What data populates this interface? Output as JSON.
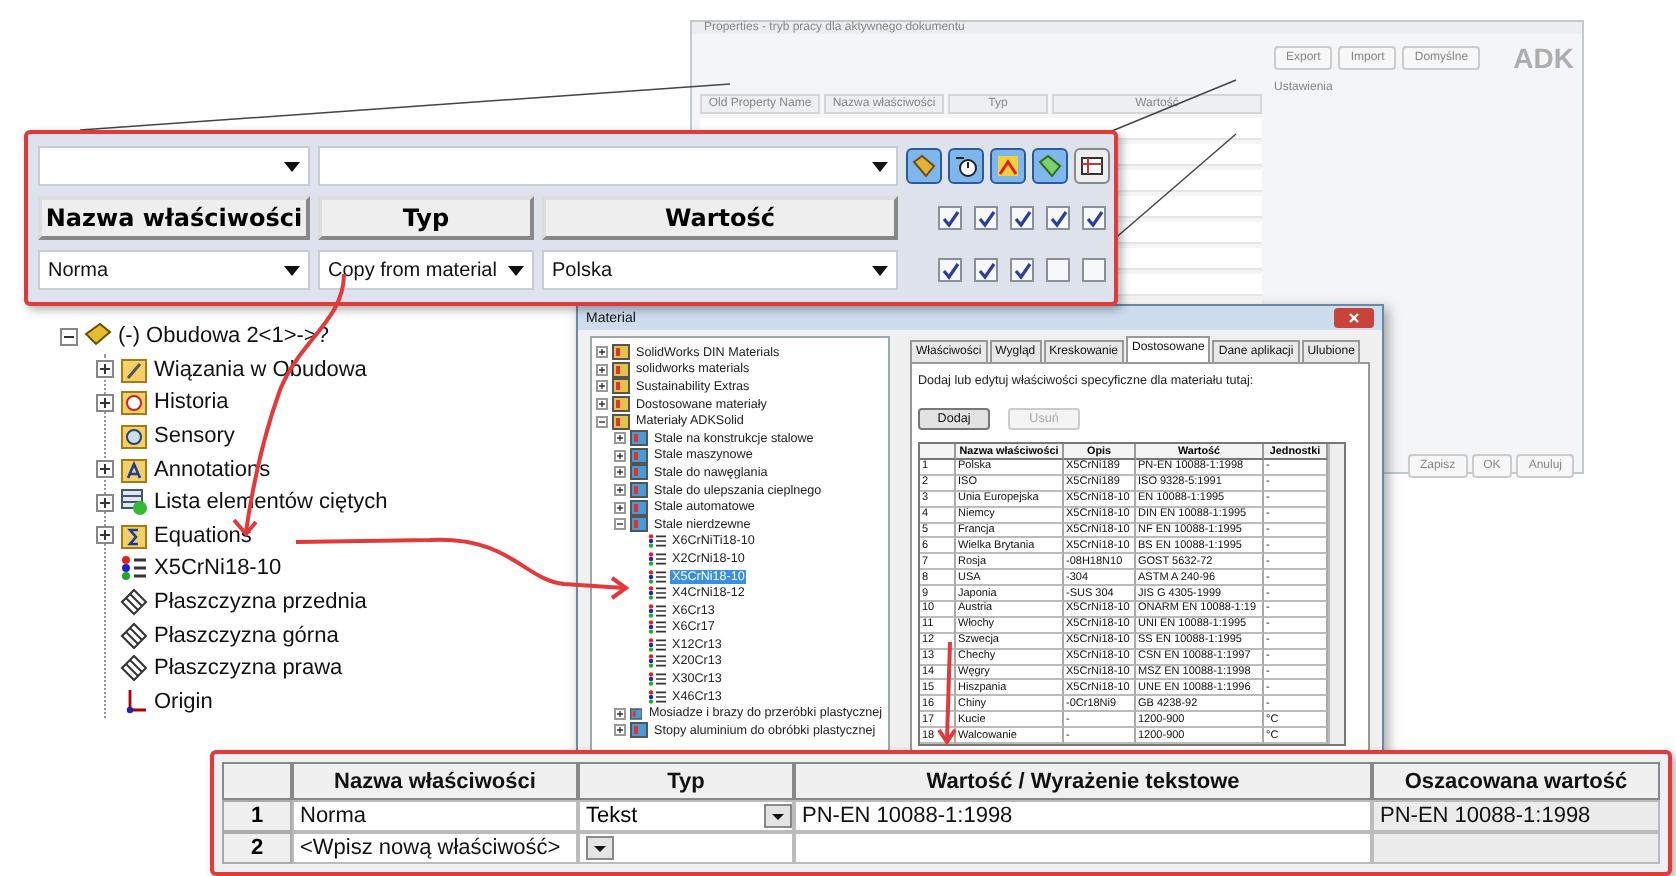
{
  "properties_dialog": {
    "title": "Properties - tryb pracy dla aktywnego dokumentu",
    "buttons": [
      "Export",
      "Import",
      "Domyślne"
    ],
    "logo": "ADK",
    "section": "Ustawienia",
    "columns": [
      "Old Property Name",
      "Nazwa właściwości",
      "Typ",
      "Wartość"
    ],
    "footer_buttons": [
      "Zapisz",
      "OK",
      "Anuluj"
    ]
  },
  "property_panel": {
    "toolbar": [
      {
        "selected": true
      },
      {
        "selected": true
      },
      {
        "selected": true
      },
      {
        "selected": true
      },
      {
        "selected": false
      }
    ],
    "columns": [
      "Nazwa właściwości",
      "Typ",
      "Wartość"
    ],
    "column_checks": [
      {
        "checked": true
      },
      {
        "checked": true
      },
      {
        "checked": true
      },
      {
        "checked": true
      },
      {
        "checked": true
      }
    ],
    "row": {
      "name": "Norma",
      "type": "Copy from material",
      "value": "Polska",
      "checks": [
        {
          "checked": true
        },
        {
          "checked": true
        },
        {
          "checked": true
        },
        {
          "checked": false
        },
        {
          "checked": false
        }
      ]
    }
  },
  "feature_tree": {
    "root": {
      "label": "(-) Obudowa 2<1>->?",
      "kind": "part",
      "expandable": true,
      "expanded": true,
      "children": [
        {
          "label": "Wiązania w Obudowa",
          "kind": "mates",
          "expandable": true,
          "expanded": false
        },
        {
          "label": "Historia",
          "kind": "history",
          "expandable": true,
          "expanded": false
        },
        {
          "label": "Sensory",
          "kind": "sensors",
          "expandable": false
        },
        {
          "label": "Annotations",
          "kind": "annotations",
          "expandable": true,
          "expanded": false
        },
        {
          "label": "Lista elementów ciętych",
          "kind": "cutlist",
          "expandable": true,
          "expanded": false
        },
        {
          "label": "Equations",
          "kind": "equations",
          "expandable": true,
          "expanded": false
        },
        {
          "label": "X5CrNi18-10",
          "kind": "material",
          "expandable": false
        },
        {
          "label": "Płaszczyzna przednia",
          "kind": "plane",
          "expandable": false
        },
        {
          "label": "Płaszczyzna górna",
          "kind": "plane",
          "expandable": false
        },
        {
          "label": "Płaszczyzna prawa",
          "kind": "plane",
          "expandable": false
        },
        {
          "label": "Origin",
          "kind": "origin",
          "expandable": false
        }
      ]
    }
  },
  "material_window": {
    "title": "Material",
    "tree": [
      {
        "label": "SolidWorks DIN Materials",
        "kind": "library",
        "expandable": true,
        "expanded": false,
        "selected": false
      },
      {
        "label": "solidworks materials",
        "kind": "library",
        "expandable": true,
        "expanded": false,
        "selected": false
      },
      {
        "label": "Sustainability Extras",
        "kind": "library",
        "expandable": true,
        "expanded": false,
        "selected": false
      },
      {
        "label": "Dostosowane materiały",
        "kind": "library",
        "expandable": true,
        "expanded": false,
        "selected": false
      },
      {
        "label": "Materiały ADKSolid",
        "kind": "library",
        "expandable": true,
        "expanded": true,
        "selected": false,
        "children": [
          {
            "label": "Stale na konstrukcje stalowe",
            "kind": "category",
            "expandable": true,
            "expanded": false,
            "selected": false
          },
          {
            "label": "Stale maszynowe",
            "kind": "category",
            "expandable": true,
            "expanded": false,
            "selected": false
          },
          {
            "label": "Stale do nawęglania",
            "kind": "category",
            "expandable": true,
            "expanded": false,
            "selected": false
          },
          {
            "label": "Stale do ulepszania cieplnego",
            "kind": "category",
            "expandable": true,
            "expanded": false,
            "selected": false
          },
          {
            "label": "Stale automatowe",
            "kind": "category",
            "expandable": true,
            "expanded": false,
            "selected": false
          },
          {
            "label": "Stale nierdzewne",
            "kind": "category",
            "expandable": true,
            "expanded": true,
            "selected": false,
            "children": [
              {
                "label": "X6CrNiTi18-10",
                "kind": "material",
                "expandable": false,
                "selected": false
              },
              {
                "label": "X2CrNi18-10",
                "kind": "material",
                "expandable": false,
                "selected": false
              },
              {
                "label": "X5CrNi18-10",
                "kind": "material",
                "expandable": false,
                "selected": true
              },
              {
                "label": "X4CrNi18-12",
                "kind": "material",
                "expandable": false,
                "selected": false
              },
              {
                "label": "X6Cr13",
                "kind": "material",
                "expandable": false,
                "selected": false
              },
              {
                "label": "X6Cr17",
                "kind": "material",
                "expandable": false,
                "selected": false
              },
              {
                "label": "X12Cr13",
                "kind": "material",
                "expandable": false,
                "selected": false
              },
              {
                "label": "X20Cr13",
                "kind": "material",
                "expandable": false,
                "selected": false
              },
              {
                "label": "X30Cr13",
                "kind": "material",
                "expandable": false,
                "selected": false
              },
              {
                "label": "X46Cr13",
                "kind": "material",
                "expandable": false,
                "selected": false
              }
            ]
          },
          {
            "label": "Mosiadze i brazy do przeróbki plastycznej",
            "kind": "category",
            "expandable": true,
            "expanded": false,
            "selected": false
          },
          {
            "label": "Stopy aluminium do obróbki plastycznej",
            "kind": "category",
            "expandable": true,
            "expanded": false,
            "selected": false
          }
        ]
      }
    ],
    "tabs": [
      {
        "label": "Właściwości",
        "selected": false
      },
      {
        "label": "Wygląd",
        "selected": false
      },
      {
        "label": "Kreskowanie",
        "selected": false
      },
      {
        "label": "Dostosowane",
        "selected": true
      },
      {
        "label": "Dane aplikacji",
        "selected": false
      },
      {
        "label": "Ulubione",
        "selected": false
      }
    ],
    "instruction": "Dodaj lub edytuj właściwości specyficzne dla materiału tutaj:",
    "buttons": [
      {
        "label": "Dodaj",
        "disabled": false
      },
      {
        "label": "Usuń",
        "disabled": true
      }
    ],
    "table": {
      "columns": [
        "",
        "Nazwa właściwości",
        "Opis",
        "Wartość",
        "Jednostki"
      ],
      "rows": [
        [
          "1",
          "Polska",
          "X5CrNi189",
          "PN-EN 10088-1:1998",
          "-"
        ],
        [
          "2",
          "ISO",
          "X5CrNi189",
          "ISO 9328-5:1991",
          "-"
        ],
        [
          "3",
          "Unia Europejska",
          "X5CrNi18-10",
          "EN 10088-1:1995",
          "-"
        ],
        [
          "4",
          "Niemcy",
          "X5CrNi18-10",
          "DIN EN 10088-1:1995",
          "-"
        ],
        [
          "5",
          "Francja",
          "X5CrNi18-10",
          "NF EN 10088-1:1995",
          "-"
        ],
        [
          "6",
          "Wielka Brytania",
          "X5CrNi18-10",
          "BS EN 10088-1:1995",
          "-"
        ],
        [
          "7",
          "Rosja",
          "-08H18N10",
          "GOST 5632-72",
          "-"
        ],
        [
          "8",
          "USA",
          "-304",
          "ASTM A 240-96",
          "-"
        ],
        [
          "9",
          "Japonia",
          "-SUS 304",
          "JIS G 4305-1999",
          "-"
        ],
        [
          "10",
          "Austria",
          "X5CrNi18-10",
          "ONARM EN 10088-1:19",
          "-"
        ],
        [
          "11",
          "Włochy",
          "X5CrNi18-10",
          "UNI EN 10088-1:1995",
          "-"
        ],
        [
          "12",
          "Szwecja",
          "X5CrNi18-10",
          "SS EN 10088-1:1995",
          "-"
        ],
        [
          "13",
          "Chechy",
          "X5CrNi18-10",
          "CSN EN 10088-1:1997",
          "-"
        ],
        [
          "14",
          "Węgry",
          "X5CrNi18-10",
          "MSZ EN 10088-1:1998",
          "-"
        ],
        [
          "15",
          "Hiszpania",
          "X5CrNi18-10",
          "UNE EN 10088-1:1996",
          "-"
        ],
        [
          "16",
          "Chiny",
          "-0Cr18Ni9",
          "GB 4238-92",
          "-"
        ],
        [
          "17",
          "Kucie",
          "-",
          "1200-900",
          "°C"
        ],
        [
          "18",
          "Walcowanie",
          "-",
          "1200-900",
          "°C"
        ]
      ]
    }
  },
  "custom_properties": {
    "columns": [
      "Nazwa właściwości",
      "Typ",
      "Wartość / Wyrażenie tekstowe",
      "Oszacowana wartość"
    ],
    "rows": [
      {
        "number": "1",
        "name": "Norma",
        "type": "Tekst",
        "value": "PN-EN 10088-1:1998",
        "evaluated": "PN-EN 10088-1:1998"
      },
      {
        "number": "2",
        "placeholder": "<Wpisz nową właściwość>"
      }
    ]
  }
}
